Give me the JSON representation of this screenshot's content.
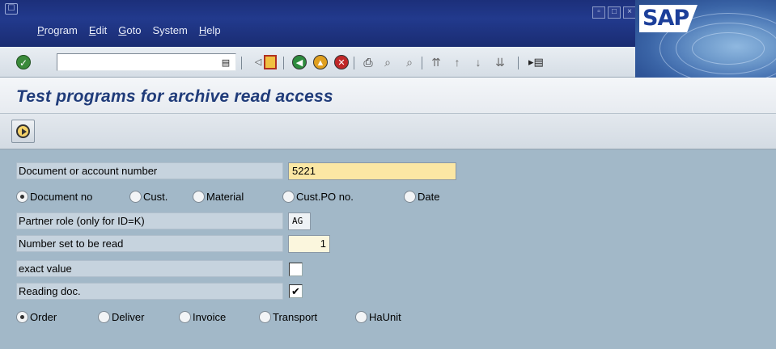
{
  "menubar": {
    "items": [
      {
        "label": "Program",
        "ul": "P",
        "rest": "rogram"
      },
      {
        "label": "Edit",
        "ul": "E",
        "rest": "dit"
      },
      {
        "label": "Goto",
        "ul": "G",
        "rest": "oto"
      },
      {
        "label": "System",
        "ul": "",
        "rest": "System"
      },
      {
        "label": "Help",
        "ul": "H",
        "rest": "elp"
      }
    ],
    "logo_text": "SAP"
  },
  "toolbar": {
    "command_value": ""
  },
  "title": {
    "text": "Test programs for archive read access"
  },
  "form": {
    "document_label": "Document or account number",
    "document_value": "5221",
    "id_options": [
      {
        "label": "Document no",
        "selected": true
      },
      {
        "label": "Cust.",
        "selected": false
      },
      {
        "label": "Material",
        "selected": false
      },
      {
        "label": "Cust.PO no.",
        "selected": false
      },
      {
        "label": "Date",
        "selected": false
      }
    ],
    "partner_label": "Partner role (only for ID=K)",
    "partner_value": "AG",
    "numset_label": "Number set to be read",
    "numset_value": "1",
    "exact_label": "exact value",
    "exact_checked": false,
    "reading_label": "Reading doc.",
    "reading_checked": true,
    "doc_options": [
      {
        "label": "Order",
        "selected": true
      },
      {
        "label": "Deliver",
        "selected": false
      },
      {
        "label": "Invoice",
        "selected": false
      },
      {
        "label": "Transport",
        "selected": false
      },
      {
        "label": "HaUnit",
        "selected": false
      }
    ]
  },
  "colors": {
    "menubar": "#1c2f7a",
    "background": "#a2b8c8",
    "required_field": "#fbe7a4",
    "title": "#203c7a"
  }
}
